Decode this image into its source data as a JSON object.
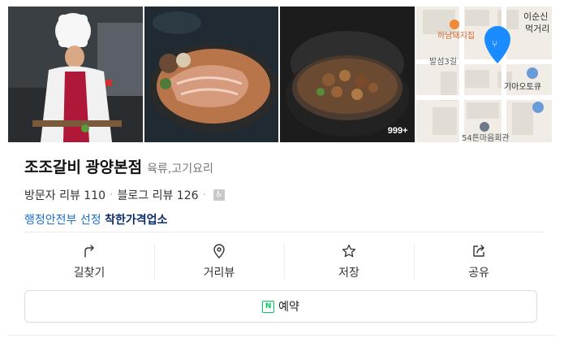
{
  "gallery": {
    "photo_count": "999+"
  },
  "map": {
    "labels": [
      "이순신",
      "먹거리",
      "하남돼지집",
      "발섬3길",
      "기아오토큐",
      "54튼마음회관"
    ]
  },
  "place": {
    "name": "조조갈비 광양본점",
    "category": "육류,고기요리",
    "visitor_reviews": "방문자 리뷰 110",
    "blog_reviews": "블로그 리뷰 126",
    "certification_prefix": "행정안전부 선정",
    "certification_name": "착한가격업소"
  },
  "actions": [
    {
      "label": "길찾기",
      "icon": "directions-icon"
    },
    {
      "label": "거리뷰",
      "icon": "location-pin-icon"
    },
    {
      "label": "저장",
      "icon": "star-icon"
    },
    {
      "label": "공유",
      "icon": "share-icon"
    }
  ],
  "reserve": {
    "label": "예약",
    "icon": "naver-booking-icon"
  },
  "colors": {
    "accent": "#03c75a",
    "link": "#1d6fcf",
    "badge": "#0a2a6e",
    "map_pin": "#1a8cff"
  }
}
